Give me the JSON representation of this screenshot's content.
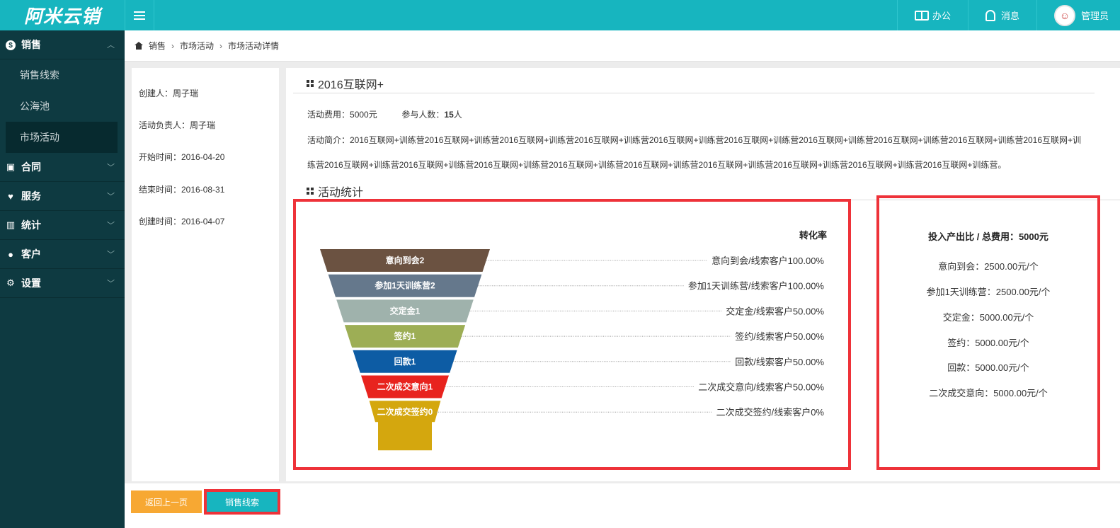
{
  "app": {
    "logo_text": "阿米云销"
  },
  "topbar": {
    "office_label": "办公",
    "messages_label": "消息",
    "user_label": "管理员"
  },
  "sidebar": {
    "groups": [
      {
        "label": "销售",
        "icon": "dollar-icon",
        "expanded": true,
        "items": [
          {
            "label": "销售线索",
            "active": false
          },
          {
            "label": "公海池",
            "active": false
          },
          {
            "label": "市场活动",
            "active": true
          }
        ]
      },
      {
        "label": "合同",
        "icon": "contract-icon"
      },
      {
        "label": "服务",
        "icon": "heart-icon"
      },
      {
        "label": "统计",
        "icon": "bar-chart-icon"
      },
      {
        "label": "客户",
        "icon": "user-icon"
      },
      {
        "label": "设置",
        "icon": "gear-icon"
      }
    ]
  },
  "breadcrumb": {
    "items": [
      "销售",
      "市场活动",
      "市场活动详情"
    ]
  },
  "info": {
    "creator": "创建人：周子瑞",
    "owner": "活动负责人：周子瑞",
    "start": "开始时间：2016-04-20",
    "end": "结束时间：2016-08-31",
    "created": "创建时间：2016-04-07"
  },
  "activity": {
    "title": "2016互联网+",
    "cost_label": "活动费用：",
    "cost_value": "5000元",
    "participants_label": "参与人数：",
    "participants_value": "15",
    "participants_unit": "人",
    "description": "活动简介：2016互联网+训练营2016互联网+训练营2016互联网+训练营2016互联网+训练营2016互联网+训练营2016互联网+训练营2016互联网+训练营2016互联网+训练营2016互联网+训练营2016互联网+训练营2016互联网+训练营2016互联网+训练营2016互联网+训练营2016互联网+训练营2016互联网+训练营2016互联网+训练营2016互联网+训练营2016互联网+训练营2016互联网+训练营。",
    "stats_title": "活动统计"
  },
  "chart_data": {
    "type": "funnel",
    "title": "转化率",
    "stages": [
      {
        "label": "意向到会2",
        "value": 2,
        "color": "#6b5241",
        "rate_label": "意向到会/线索客户100.00%"
      },
      {
        "label": "参加1天训练营2",
        "value": 2,
        "color": "#65788c",
        "rate_label": "参加1天训练营/线索客户100.00%"
      },
      {
        "label": "交定金1",
        "value": 1,
        "color": "#9fb2ac",
        "rate_label": "交定金/线索客户50.00%"
      },
      {
        "label": "签约1",
        "value": 1,
        "color": "#9dae55",
        "rate_label": "签约/线索客户50.00%"
      },
      {
        "label": "回款1",
        "value": 1,
        "color": "#0d5ca4",
        "rate_label": "回款/线索客户50.00%"
      },
      {
        "label": "二次成交意向1",
        "value": 1,
        "color": "#e8231e",
        "rate_label": "二次成交意向/线索客户50.00%"
      },
      {
        "label": "二次成交签约0",
        "value": 0,
        "color": "#d4a70e",
        "rate_label": "二次成交签约/线索客户0%"
      }
    ]
  },
  "roi": {
    "title": "投入产出比 / 总费用：5000元",
    "rows": [
      "意向到会：2500.00元/个",
      "参加1天训练营：2500.00元/个",
      "交定金：5000.00元/个",
      "签约：5000.00元/个",
      "回款：5000.00元/个",
      "二次成交意向：5000.00元/个"
    ]
  },
  "actions": {
    "back_label": "返回上一页",
    "leads_label": "销售线索"
  }
}
